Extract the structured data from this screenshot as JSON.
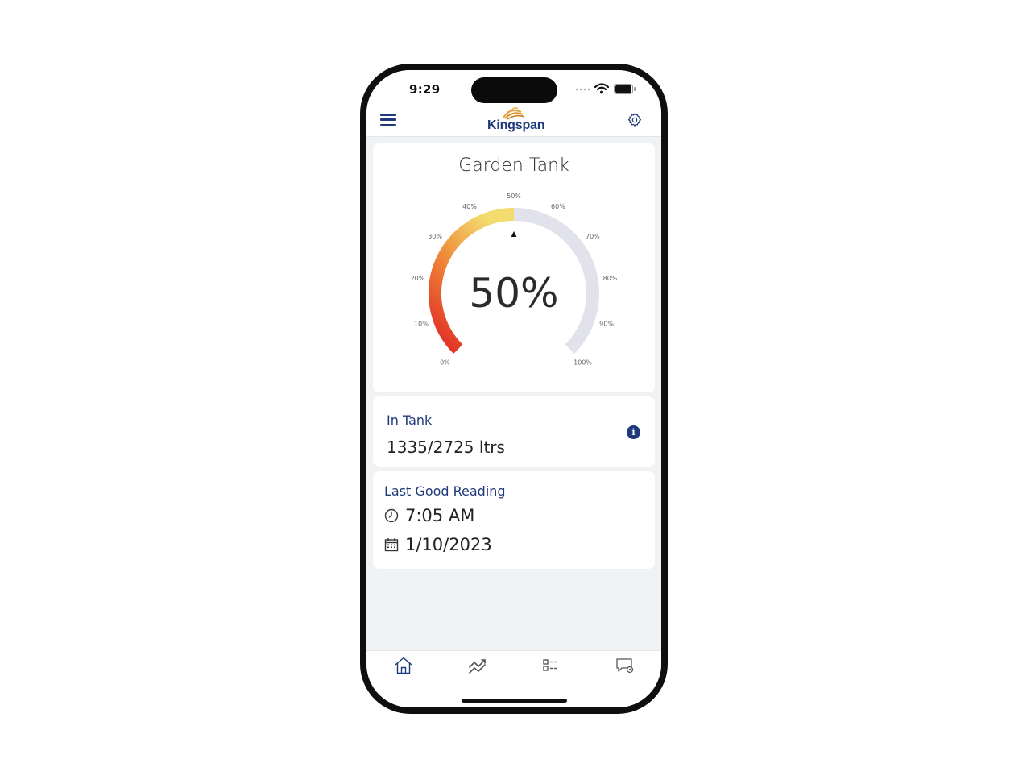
{
  "status_bar": {
    "time": "9:29"
  },
  "header": {
    "logo_text": "Kingspan",
    "menu_icon": "hamburger-menu-icon",
    "settings_icon": "gear-icon",
    "accent_color": "#1f3a7a"
  },
  "gauge": {
    "title": "Garden Tank",
    "value_percent": 50,
    "value_label": "50%",
    "tick_labels": [
      "0%",
      "10%",
      "20%",
      "30%",
      "40%",
      "50%",
      "60%",
      "70%",
      "80%",
      "90%",
      "100%"
    ],
    "fill_colors": [
      "#e02424",
      "#f3dc6f"
    ],
    "track_color": "#e1e2ec"
  },
  "in_tank": {
    "label": "In Tank",
    "value": "1335/2725 ltrs",
    "info_glyph": "i"
  },
  "last_reading": {
    "label": "Last Good Reading",
    "time": "7:05 AM",
    "date": "1/10/2023"
  },
  "tabs": [
    {
      "icon": "home-icon"
    },
    {
      "icon": "trend-chart-icon"
    },
    {
      "icon": "checklist-icon"
    },
    {
      "icon": "message-settings-icon"
    }
  ]
}
